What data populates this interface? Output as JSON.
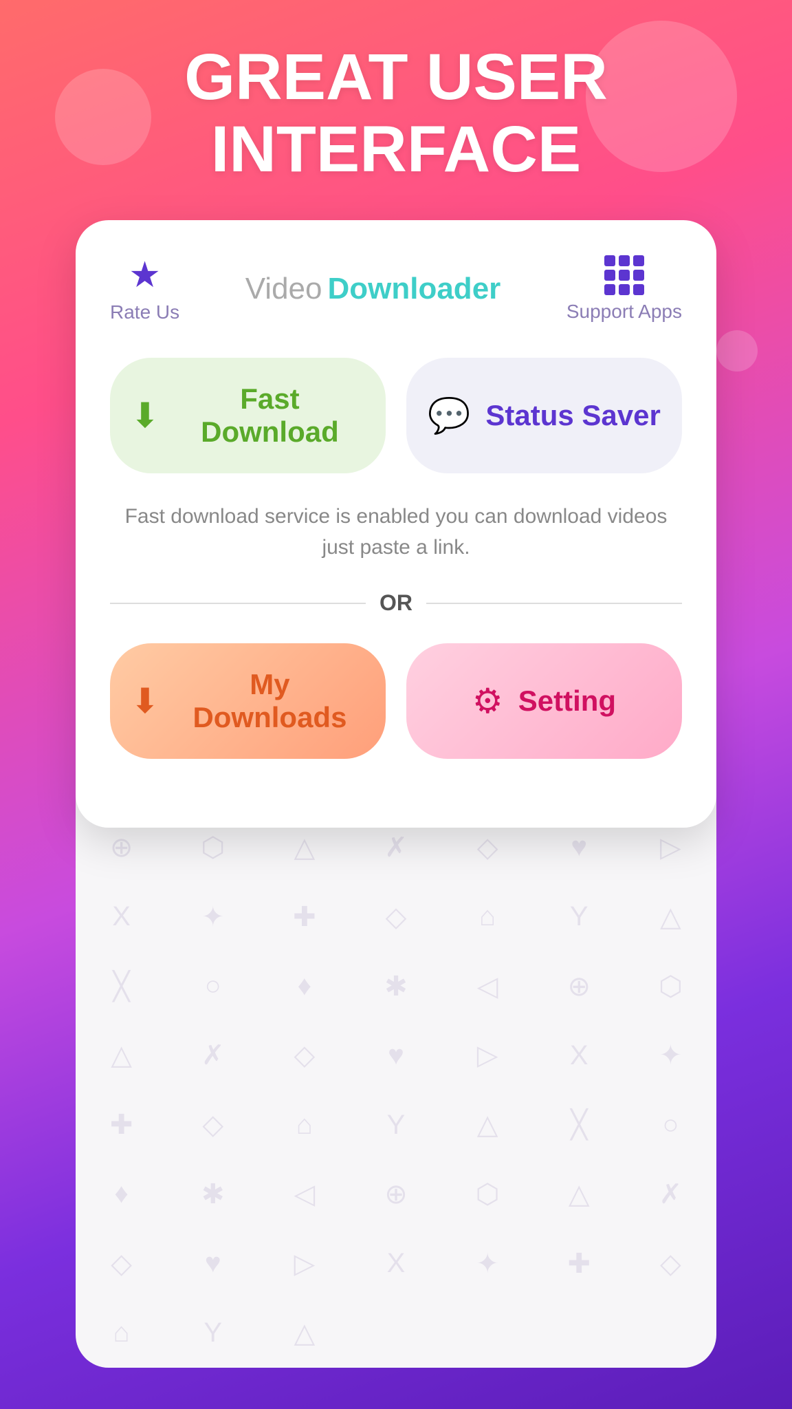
{
  "background": {
    "gradient_start": "#ff6b6b",
    "gradient_end": "#5b1db8"
  },
  "hero": {
    "title_line1": "GREAT USER",
    "title_line2": "INTERFACE"
  },
  "card": {
    "header": {
      "rate_us_label": "Rate Us",
      "app_title_video": "Video",
      "app_title_downloader": "Downloader",
      "support_apps_label": "Support Apps"
    },
    "fast_download_label": "Fast Download",
    "status_saver_label": "Status Saver",
    "description": "Fast download service is enabled you can download videos just paste a link.",
    "or_divider": "OR",
    "my_downloads_label": "My Downloads",
    "setting_label": "Setting"
  },
  "pattern_symbols": [
    "♥",
    "▷",
    "X",
    "✦",
    "✚",
    "◇",
    "⌂",
    "Y",
    "△",
    "╳",
    "○",
    "♦",
    "✱",
    "◁",
    "⊕",
    "⬡",
    "△",
    "✗",
    "◇",
    "♥",
    "▷",
    "X",
    "✦",
    "✚",
    "◇",
    "⌂",
    "Y",
    "△",
    "╳",
    "○",
    "♦",
    "✱",
    "◁",
    "⊕",
    "⬡",
    "△",
    "✗",
    "◇",
    "♥",
    "▷",
    "X",
    "✦",
    "✚",
    "◇",
    "⌂",
    "Y",
    "△",
    "╳",
    "○",
    "♦",
    "✱",
    "◁",
    "⊕",
    "⬡",
    "△",
    "✗",
    "◇",
    "♥",
    "▷",
    "X",
    "✦",
    "✚",
    "◇",
    "⌂",
    "Y",
    "△"
  ]
}
